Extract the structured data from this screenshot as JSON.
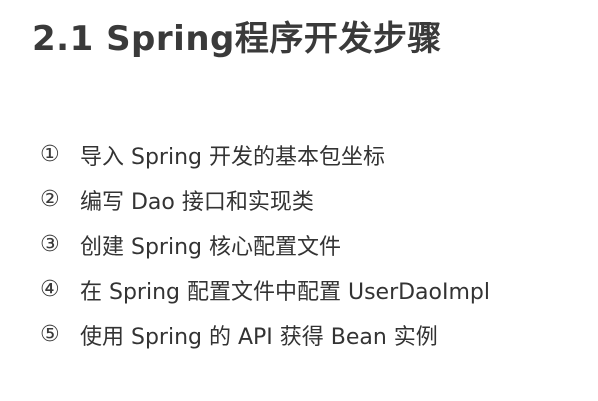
{
  "slide": {
    "title": "2.1 Spring程序开发步骤",
    "steps": [
      {
        "num": "①",
        "text": "导入 Spring 开发的基本包坐标"
      },
      {
        "num": "②",
        "text": "编写 Dao 接口和实现类"
      },
      {
        "num": "③",
        "text": "创建 Spring 核心配置文件"
      },
      {
        "num": "④",
        "text": "在 Spring 配置文件中配置 UserDaoImpl"
      },
      {
        "num": "⑤",
        "text": "使用 Spring 的 API 获得 Bean 实例"
      }
    ]
  }
}
